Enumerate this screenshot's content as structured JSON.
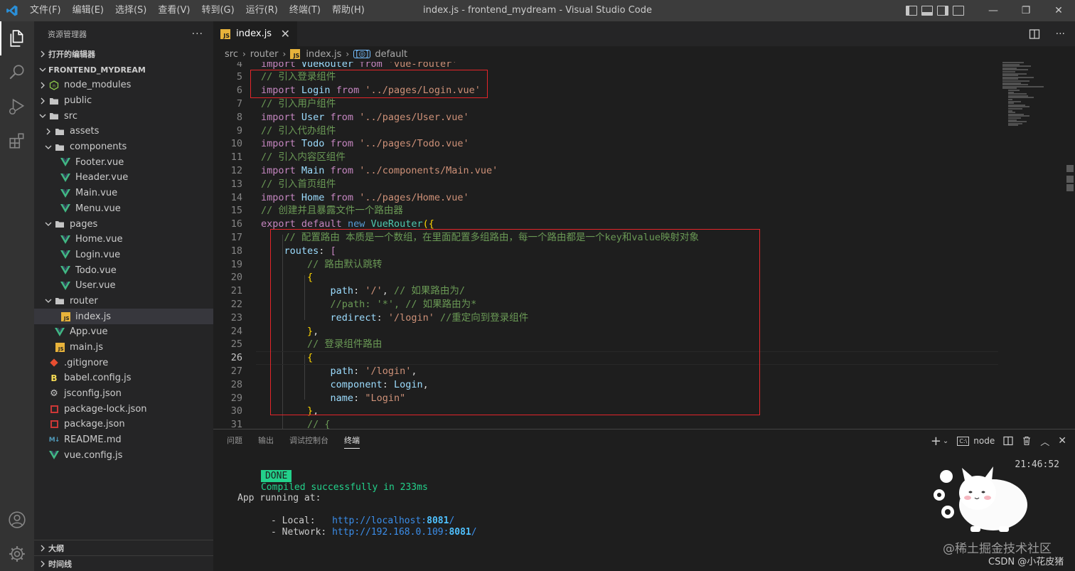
{
  "window": {
    "title": "index.js - frontend_mydream - Visual Studio Code",
    "menu": [
      "文件(F)",
      "编辑(E)",
      "选择(S)",
      "查看(V)",
      "转到(G)",
      "运行(R)",
      "终端(T)",
      "帮助(H)"
    ],
    "controls": {
      "minimize": "—",
      "restore": "❐",
      "close": "✕"
    }
  },
  "activity_bar": {
    "top": [
      "files-icon",
      "search-icon",
      "run-debug-icon",
      "extensions-icon"
    ],
    "bottom": [
      "account-icon",
      "settings-gear-icon"
    ]
  },
  "sidebar": {
    "title": "资源管理器",
    "more": "···",
    "open_editors": "打开的编辑器",
    "project": "FRONTEND_MYDREAM",
    "tree": [
      {
        "label": "node_modules",
        "depth": 1,
        "kind": "folder-node",
        "open": false
      },
      {
        "label": "public",
        "depth": 1,
        "kind": "folder",
        "open": false
      },
      {
        "label": "src",
        "depth": 1,
        "kind": "folder",
        "open": true
      },
      {
        "label": "assets",
        "depth": 2,
        "kind": "folder",
        "open": false
      },
      {
        "label": "components",
        "depth": 2,
        "kind": "folder",
        "open": true
      },
      {
        "label": "Footer.vue",
        "depth": 3,
        "kind": "vue"
      },
      {
        "label": "Header.vue",
        "depth": 3,
        "kind": "vue"
      },
      {
        "label": "Main.vue",
        "depth": 3,
        "kind": "vue"
      },
      {
        "label": "Menu.vue",
        "depth": 3,
        "kind": "vue"
      },
      {
        "label": "pages",
        "depth": 2,
        "kind": "folder",
        "open": true
      },
      {
        "label": "Home.vue",
        "depth": 3,
        "kind": "vue"
      },
      {
        "label": "Login.vue",
        "depth": 3,
        "kind": "vue"
      },
      {
        "label": "Todo.vue",
        "depth": 3,
        "kind": "vue"
      },
      {
        "label": "User.vue",
        "depth": 3,
        "kind": "vue"
      },
      {
        "label": "router",
        "depth": 2,
        "kind": "folder",
        "open": true
      },
      {
        "label": "index.js",
        "depth": 3,
        "kind": "js",
        "selected": true
      },
      {
        "label": "App.vue",
        "depth": 2,
        "kind": "vue"
      },
      {
        "label": "main.js",
        "depth": 2,
        "kind": "js"
      },
      {
        "label": ".gitignore",
        "depth": 1,
        "kind": "git"
      },
      {
        "label": "babel.config.js",
        "depth": 1,
        "kind": "babel"
      },
      {
        "label": "jsconfig.json",
        "depth": 1,
        "kind": "json"
      },
      {
        "label": "package-lock.json",
        "depth": 1,
        "kind": "npm"
      },
      {
        "label": "package.json",
        "depth": 1,
        "kind": "npm"
      },
      {
        "label": "README.md",
        "depth": 1,
        "kind": "md"
      },
      {
        "label": "vue.config.js",
        "depth": 1,
        "kind": "vue"
      }
    ],
    "outline": "大纲",
    "timeline": "时间线"
  },
  "editor": {
    "tab": {
      "label": "index.js",
      "close": "✕"
    },
    "breadcrumb": [
      "src",
      "router",
      "index.js",
      "default"
    ],
    "current_line": 26,
    "lines": [
      {
        "n": 4,
        "tokens": [
          [
            "k",
            "import "
          ],
          [
            "v",
            "VueRouter "
          ],
          [
            "k",
            "from "
          ],
          [
            "s",
            "'vue-router'"
          ]
        ]
      },
      {
        "n": 5,
        "tokens": [
          [
            "c",
            "// 引入登录组件"
          ]
        ]
      },
      {
        "n": 6,
        "tokens": [
          [
            "k",
            "import "
          ],
          [
            "v",
            "Login "
          ],
          [
            "k",
            "from "
          ],
          [
            "s",
            "'../pages/Login.vue'"
          ]
        ]
      },
      {
        "n": 7,
        "tokens": [
          [
            "c",
            "// 引入用户组件"
          ]
        ]
      },
      {
        "n": 8,
        "tokens": [
          [
            "k",
            "import "
          ],
          [
            "v",
            "User "
          ],
          [
            "k",
            "from "
          ],
          [
            "s",
            "'../pages/User.vue'"
          ]
        ]
      },
      {
        "n": 9,
        "tokens": [
          [
            "c",
            "// 引入代办组件"
          ]
        ]
      },
      {
        "n": 10,
        "tokens": [
          [
            "k",
            "import "
          ],
          [
            "v",
            "Todo "
          ],
          [
            "k",
            "from "
          ],
          [
            "s",
            "'../pages/Todo.vue'"
          ]
        ]
      },
      {
        "n": 11,
        "tokens": [
          [
            "c",
            "// 引入内容区组件"
          ]
        ]
      },
      {
        "n": 12,
        "tokens": [
          [
            "k",
            "import "
          ],
          [
            "v",
            "Main "
          ],
          [
            "k",
            "from "
          ],
          [
            "s",
            "'../components/Main.vue'"
          ]
        ]
      },
      {
        "n": 13,
        "tokens": [
          [
            "c",
            "// 引入首页组件"
          ]
        ]
      },
      {
        "n": 14,
        "tokens": [
          [
            "k",
            "import "
          ],
          [
            "v",
            "Home "
          ],
          [
            "k",
            "from "
          ],
          [
            "s",
            "'../pages/Home.vue'"
          ]
        ]
      },
      {
        "n": 15,
        "tokens": [
          [
            "c",
            "// 创建并且暴露文件一个路由器"
          ]
        ]
      },
      {
        "n": 16,
        "tokens": [
          [
            "k",
            "export "
          ],
          [
            "k",
            "default "
          ],
          [
            "b",
            "new "
          ],
          [
            "f",
            "VueRouter"
          ],
          [
            "y",
            "({"
          ]
        ]
      },
      {
        "n": 17,
        "tokens": [
          [
            "p",
            "    "
          ],
          [
            "c",
            "// 配置路由 本质是一个数组，在里面配置多组路由，每一个路由都是一个key和value映射对象"
          ]
        ]
      },
      {
        "n": 18,
        "tokens": [
          [
            "p",
            "    "
          ],
          [
            "v",
            "routes"
          ],
          [
            "p",
            ": "
          ],
          [
            "k",
            "["
          ]
        ]
      },
      {
        "n": 19,
        "tokens": [
          [
            "p",
            "        "
          ],
          [
            "c",
            "// 路由默认跳转"
          ]
        ]
      },
      {
        "n": 20,
        "tokens": [
          [
            "p",
            "        "
          ],
          [
            "y",
            "{"
          ]
        ]
      },
      {
        "n": 21,
        "tokens": [
          [
            "p",
            "            "
          ],
          [
            "v",
            "path"
          ],
          [
            "p",
            ": "
          ],
          [
            "s",
            "'/'"
          ],
          [
            "p",
            ", "
          ],
          [
            "c",
            "// 如果路由为/"
          ]
        ]
      },
      {
        "n": 22,
        "tokens": [
          [
            "p",
            "            "
          ],
          [
            "c",
            "//path: '*', // 如果路由为*"
          ]
        ]
      },
      {
        "n": 23,
        "tokens": [
          [
            "p",
            "            "
          ],
          [
            "v",
            "redirect"
          ],
          [
            "p",
            ": "
          ],
          [
            "s",
            "'/login'"
          ],
          [
            "p",
            " "
          ],
          [
            "c",
            "//重定向到登录组件"
          ]
        ]
      },
      {
        "n": 24,
        "tokens": [
          [
            "p",
            "        "
          ],
          [
            "y",
            "}"
          ],
          [
            "p",
            ","
          ]
        ]
      },
      {
        "n": 25,
        "tokens": [
          [
            "p",
            "        "
          ],
          [
            "c",
            "// 登录组件路由"
          ]
        ]
      },
      {
        "n": 26,
        "tokens": [
          [
            "p",
            "        "
          ],
          [
            "y",
            "{"
          ]
        ]
      },
      {
        "n": 27,
        "tokens": [
          [
            "p",
            "            "
          ],
          [
            "v",
            "path"
          ],
          [
            "p",
            ": "
          ],
          [
            "s",
            "'/login'"
          ],
          [
            "p",
            ","
          ]
        ]
      },
      {
        "n": 28,
        "tokens": [
          [
            "p",
            "            "
          ],
          [
            "v",
            "component"
          ],
          [
            "p",
            ": "
          ],
          [
            "v",
            "Login"
          ],
          [
            "p",
            ","
          ]
        ]
      },
      {
        "n": 29,
        "tokens": [
          [
            "p",
            "            "
          ],
          [
            "v",
            "name"
          ],
          [
            "p",
            ": "
          ],
          [
            "s",
            "\"Login\""
          ]
        ]
      },
      {
        "n": 30,
        "tokens": [
          [
            "p",
            "        "
          ],
          [
            "y",
            "}"
          ],
          [
            "p",
            ","
          ]
        ]
      },
      {
        "n": 31,
        "tokens": [
          [
            "p",
            "        "
          ],
          [
            "c",
            "// {"
          ]
        ]
      }
    ]
  },
  "panel": {
    "tabs": [
      "问题",
      "输出",
      "调试控制台",
      "终端"
    ],
    "active_tab": "终端",
    "terminal_name": "node",
    "time": "21:46:52",
    "done": "DONE",
    "compiled": "Compiled successfully in 233ms",
    "app_running": "App running at:",
    "local_label": "- Local:   ",
    "local_url_prefix": "http://localhost:",
    "local_port": "8081",
    "local_url_suffix": "/",
    "network_label": "- Network: ",
    "network_url_prefix": "http://192.168.0.109:",
    "network_port": "8081",
    "network_url_suffix": "/"
  },
  "watermark": {
    "line1": "@稀土掘金技术社区",
    "line2": "CSDN @小花皮猪"
  },
  "colors": {
    "accent": "#007acc",
    "highlight_box": "#e5252a",
    "terminal_green": "#23d18b"
  }
}
